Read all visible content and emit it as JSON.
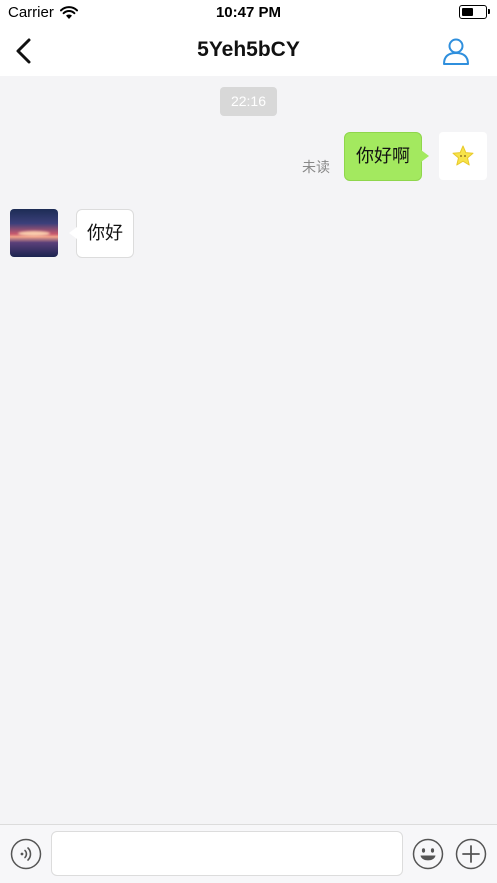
{
  "status_bar": {
    "carrier": "Carrier",
    "time": "10:47 PM",
    "battery_level": 0.45
  },
  "nav": {
    "title": "5Yeh5bCY",
    "back_icon": "chevron-left-icon",
    "profile_icon": "user-icon"
  },
  "chat": {
    "timestamp": "22:16",
    "messages": [
      {
        "direction": "outgoing",
        "text": "你好啊",
        "status": "未读",
        "avatar": "star-avatar"
      },
      {
        "direction": "incoming",
        "text": "你好",
        "avatar": "sunset-avatar"
      }
    ]
  },
  "input_bar": {
    "voice_icon": "voice-icon",
    "emoji_icon": "emoji-icon",
    "plus_icon": "plus-icon",
    "value": "",
    "placeholder": ""
  },
  "colors": {
    "outgoing_bubble": "#a3e95f",
    "incoming_bubble": "#ffffff",
    "accent": "#2f8fdd",
    "background": "#f4f4f6"
  }
}
